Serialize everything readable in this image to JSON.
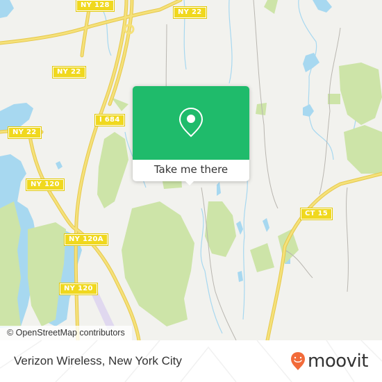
{
  "map": {
    "road_labels": [
      {
        "id": "ny128",
        "text": "NY 128"
      },
      {
        "id": "ny22a",
        "text": "NY 22"
      },
      {
        "id": "ny22b",
        "text": "NY 22"
      },
      {
        "id": "ny22c",
        "text": "NY 22"
      },
      {
        "id": "i684",
        "text": "I 684"
      },
      {
        "id": "ny120a",
        "text": "NY 120"
      },
      {
        "id": "ny120A",
        "text": "NY 120A"
      },
      {
        "id": "ny120b",
        "text": "NY 120"
      },
      {
        "id": "ct15",
        "text": "CT 15"
      }
    ],
    "attribution": "© OpenStreetMap contributors",
    "colors": {
      "land": "#f2f2ee",
      "water": "#a7d8f0",
      "park": "#cde4a8",
      "highway": "#f5e17a",
      "popup": "#1fbb6b"
    }
  },
  "popup": {
    "icon": "map-pin-icon",
    "button_label": "Take me there"
  },
  "footer": {
    "place_name": "Verizon Wireless, New York City",
    "brand": "moovit",
    "brand_color": "#f26b3a"
  }
}
